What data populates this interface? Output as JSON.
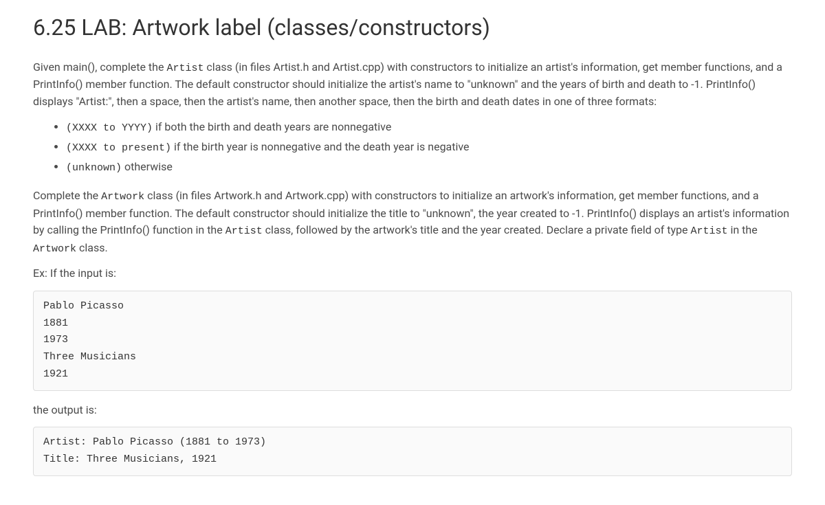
{
  "title": "6.25 LAB: Artwork label (classes/constructors)",
  "para1_a": "Given main(), complete the ",
  "para1_code1": "Artist",
  "para1_b": " class (in files Artist.h and Artist.cpp) with constructors to initialize an artist's information, get member functions, and a PrintInfo() member function. The default constructor should initialize the artist's name to \"unknown\" and the years of birth and death to -1. PrintInfo() displays \"Artist:\", then a space, then the artist's name, then another space, then the birth and death dates in one of three formats:",
  "bullets": {
    "b1_code": "(XXXX to YYYY)",
    "b1_text": " if both the birth and death years are nonnegative",
    "b2_code": "(XXXX to present)",
    "b2_text": " if the birth year is nonnegative and the death year is negative",
    "b3_code": "(unknown)",
    "b3_text": " otherwise"
  },
  "para2_a": "Complete the ",
  "para2_code1": "Artwork",
  "para2_b": " class (in files Artwork.h and Artwork.cpp) with constructors to initialize an artwork's information, get member functions, and a PrintInfo() member function. The default constructor should initialize the title to \"unknown\", the year created to -1. PrintInfo() displays an artist's information by calling the PrintInfo() function in the ",
  "para2_code2": "Artist",
  "para2_c": " class, followed by the artwork's title and the year created. Declare a private field of type ",
  "para2_code3": "Artist",
  "para2_d": " in the ",
  "para2_code4": "Artwork",
  "para2_e": " class.",
  "ex_label": "Ex: If the input is:",
  "input_block": "Pablo Picasso\n1881\n1973\nThree Musicians\n1921",
  "output_label": "the output is:",
  "output_block": "Artist: Pablo Picasso (1881 to 1973)\nTitle: Three Musicians, 1921"
}
